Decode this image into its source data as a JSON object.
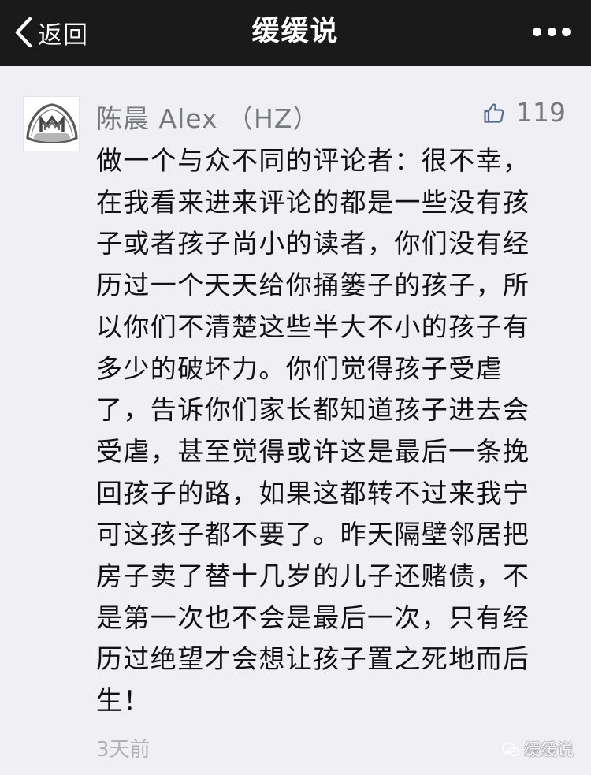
{
  "nav": {
    "back_label": "返回",
    "title": "缓缓说",
    "more_icon": "more-dots-icon",
    "bg_color": "#1a1a1a"
  },
  "comment": {
    "author": "陈晨 Alex （HZ）",
    "like_count": "119",
    "lines": [
      "做一个与众不同的评论者：很不幸，",
      "在我看来进来评论的都是一些没有孩",
      "子或者孩子尚小的读者，你们没有经",
      "历过一个天天给你捅篓子的孩子，所",
      "以你们不清楚这些半大不小的孩子有",
      "多少的破坏力。你们觉得孩子受虐",
      "了，告诉你们家长都知道孩子进去会",
      "受虐，甚至觉得或许这是最后一条挽",
      "回孩子的路，如果这都转不过来我宁",
      "可这孩子都不要了。昨天隔壁邻居把",
      "房子卖了替十几岁的儿子还赌债，不",
      "是第一次也不会是最后一次，只有经",
      "历过绝望才会想让孩子置之死地而后",
      "生！"
    ],
    "time": "3天前"
  },
  "watermark": {
    "text": "缓缓说"
  },
  "colors": {
    "page_bg": "#efeff4",
    "meta_text": "#76797e",
    "body_text": "#111111",
    "time_text": "#b2b2b2"
  }
}
